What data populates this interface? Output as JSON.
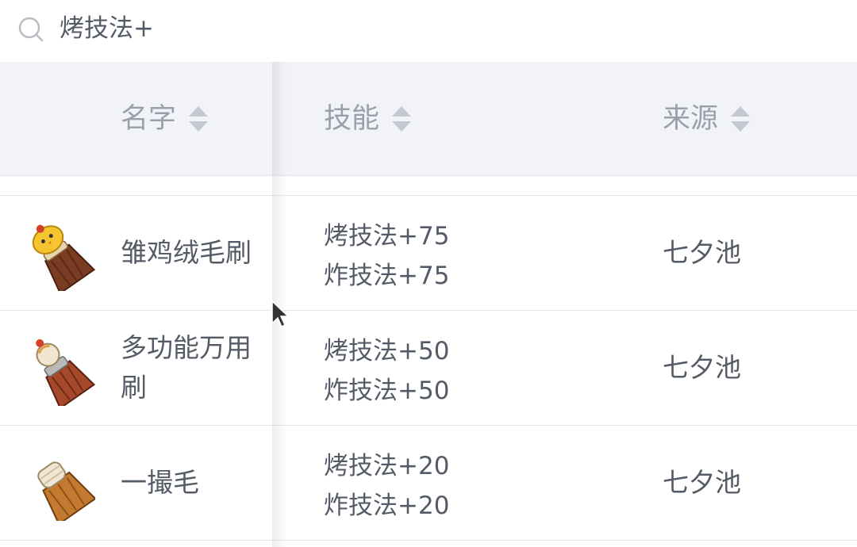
{
  "search": {
    "query": "烤技法+",
    "icon": "search-icon"
  },
  "table": {
    "headers": [
      {
        "label": "名字",
        "sort_icon": "sort-icon"
      },
      {
        "label": "技能",
        "sort_icon": "sort-icon"
      },
      {
        "label": "来源",
        "sort_icon": "sort-icon"
      }
    ],
    "rows": [
      {
        "icon": "chick-fluff-brush-icon",
        "name": "雏鸡绒毛刷",
        "skills": [
          "烤技法+75",
          "炸技法+75"
        ],
        "source": "七夕池"
      },
      {
        "icon": "multipurpose-brush-icon",
        "name": "多功能万用刷",
        "skills": [
          "烤技法+50",
          "炸技法+50"
        ],
        "source": "七夕池"
      },
      {
        "icon": "tuft-brush-icon",
        "name": "一撮毛",
        "skills": [
          "烤技法+20",
          "炸技法+20"
        ],
        "source": "七夕池"
      }
    ]
  },
  "colors": {
    "header_bg": "#f1f3f9",
    "text": "#555b66",
    "header_text": "#9aa0aa",
    "divider": "#e6e8ee"
  }
}
